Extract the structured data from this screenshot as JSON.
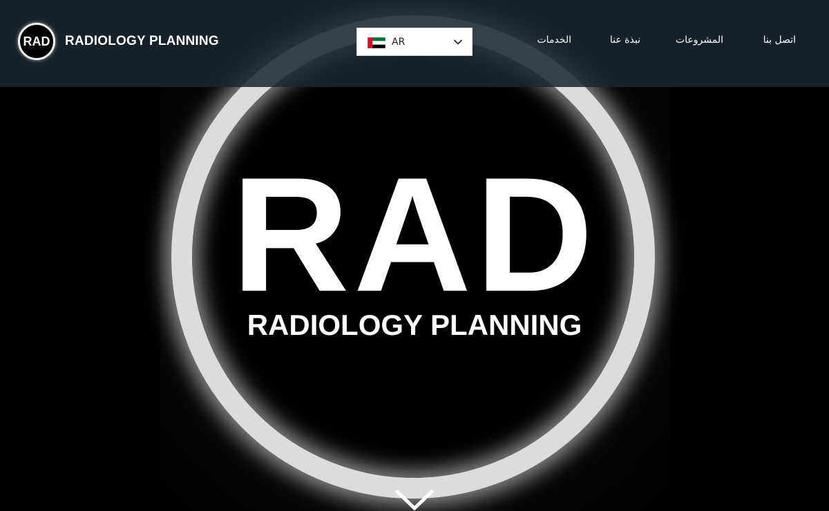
{
  "header": {
    "logo_badge": "RAD",
    "logo_text": "RADIOLOGY PLANNING",
    "language": {
      "code": "AR",
      "flag": "uae-flag",
      "chevron": "chevron-down-icon"
    },
    "nav": [
      {
        "label": "اتصل بنا"
      },
      {
        "label": "المشروعات"
      },
      {
        "label": "نبذة عنا"
      },
      {
        "label": "الخدمات"
      }
    ]
  },
  "hero": {
    "title": "RAD",
    "subtitle": "RADIOLOGY PLANNING",
    "scroll_icon": "chevron-down-icon"
  },
  "colors": {
    "header_bg": "#1b2630",
    "ring": "#dcdcdc",
    "flag_red": "#ce1126",
    "flag_green": "#00732f"
  }
}
